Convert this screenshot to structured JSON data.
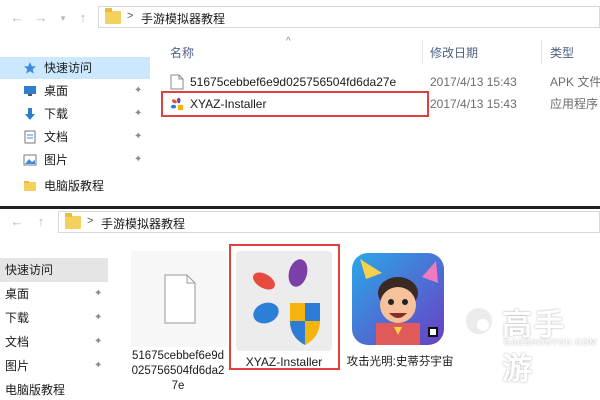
{
  "top_window": {
    "address_path": "手游模拟器教程",
    "address_separator": ">",
    "back_glyph": "←",
    "forward_glyph": "→",
    "columns": {
      "name": "名称",
      "modified": "修改日期",
      "type": "类型"
    },
    "sidebar": [
      {
        "label": "快速访问",
        "icon": "star-icon",
        "selected": true
      },
      {
        "label": "桌面",
        "icon": "desktop-icon",
        "pinned": true
      },
      {
        "label": "下载",
        "icon": "download-icon",
        "pinned": true
      },
      {
        "label": "文档",
        "icon": "document-icon",
        "pinned": true
      },
      {
        "label": "图片",
        "icon": "picture-icon",
        "pinned": true
      },
      {
        "label": "电脑版教程",
        "icon": "folder-icon"
      }
    ],
    "files": [
      {
        "name": "51675cebbef6e9d025756504fd6da27e",
        "modified": "2017/4/13 15:43",
        "type": "APK 文件",
        "icon": "blank-file-icon"
      },
      {
        "name": "XYAZ-Installer",
        "modified": "2017/4/13 15:43",
        "type": "应用程序",
        "icon": "xyaz-app-icon",
        "highlighted": true
      }
    ]
  },
  "bottom_window": {
    "address_path": "手游模拟器教程",
    "address_separator": ">",
    "sidebar": [
      {
        "label": "快速访问",
        "selected": true
      },
      {
        "label": "桌面",
        "pinned": true
      },
      {
        "label": "下载",
        "pinned": true
      },
      {
        "label": "文档",
        "pinned": true
      },
      {
        "label": "图片",
        "pinned": true
      },
      {
        "label": "电脑版教程"
      }
    ],
    "tiles": [
      {
        "caption": "51675cebbef6e9d025756504fd6da27e",
        "icon": "blank-file-icon"
      },
      {
        "caption": "XYAZ-Installer",
        "icon": "xyaz-installer-icon",
        "highlighted": true
      },
      {
        "caption": "攻击光明:史蒂芬宇宙",
        "icon": "game-app-icon"
      }
    ]
  },
  "watermark": {
    "text": "高手游",
    "subtext": "GAOSHOUYOU.COM"
  },
  "colors": {
    "highlight": "#e0413f",
    "selected_sidebar": "#cce8ff",
    "folder": "#f4d05d"
  },
  "pin_glyph": "📌"
}
